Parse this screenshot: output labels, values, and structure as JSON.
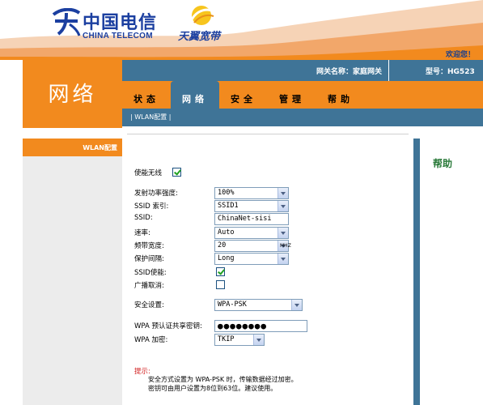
{
  "header": {
    "brand_cn": "中国电信",
    "brand_en": "CHINA TELECOM",
    "product": "天翼宽带",
    "welcome": "欢迎您！",
    "icons": {
      "brand": "china-telecom-logo-icon",
      "product": "tianyi-sun-logo-icon"
    },
    "colors": {
      "brand_blue": "#1b3fa0",
      "accent_orange": "#f28a1e",
      "bar_blue": "#3f7497"
    }
  },
  "section": {
    "title": "网络"
  },
  "topbar": {
    "gateway_label": "网关名称：",
    "gateway_value": "家庭网关",
    "model_label": "型号：",
    "model_value": "HG523"
  },
  "nav": {
    "tabs": [
      {
        "label": "状态",
        "active": false
      },
      {
        "label": "网络",
        "active": true
      },
      {
        "label": "安全",
        "active": false
      },
      {
        "label": "管理",
        "active": false
      },
      {
        "label": "帮助",
        "active": false
      }
    ]
  },
  "subnav": {
    "item": "| WLAN配置 |"
  },
  "sidebar": {
    "items": [
      {
        "label": "WLAN配置",
        "active": true
      }
    ]
  },
  "form": {
    "enable_wireless": {
      "label": "使能无线",
      "checked": true
    },
    "tx_power": {
      "label": "发射功率强度:",
      "value": "100%"
    },
    "ssid_index": {
      "label": "SSID 索引:",
      "value": "SSID1"
    },
    "ssid": {
      "label": "SSID:",
      "value": "ChinaNet-sisi"
    },
    "rate": {
      "label": "速率:",
      "value": "Auto"
    },
    "bandwidth": {
      "label": "频带宽度:",
      "value": "20",
      "unit": "MHZ"
    },
    "guard_interval": {
      "label": "保护间隔:",
      "value": "Long"
    },
    "ssid_enable": {
      "label": "SSID使能:",
      "checked": true
    },
    "broadcast_cancel": {
      "label": "广播取消:",
      "checked": false
    },
    "security": {
      "label": "安全设置:",
      "value": "WPA-PSK"
    },
    "wpa_key": {
      "label": "WPA 预认证共享密钥:",
      "value": "●●●●●●●●"
    },
    "wpa_encryption": {
      "label": "WPA 加密:",
      "value": "TKIP"
    }
  },
  "tip": {
    "title": "提示:",
    "line1": "安全方式设置为 WPA-PSK 时，传输数据经过加密。",
    "line2": "密钥可由用户设置为8位到63位。建议使用。"
  },
  "help": {
    "title": "帮助"
  }
}
